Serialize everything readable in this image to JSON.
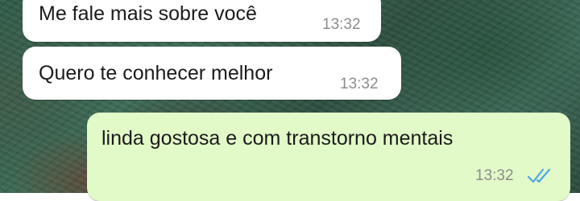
{
  "messages": [
    {
      "direction": "incoming",
      "text": "Me fale mais sobre você",
      "time": "13:32"
    },
    {
      "direction": "incoming",
      "text": "Quero te conhecer melhor",
      "time": "13:32"
    },
    {
      "direction": "outgoing",
      "text": "linda gostosa e com transtorno mentais",
      "time": "13:32",
      "status_icon": "double-check-read-icon"
    }
  ],
  "colors": {
    "incoming_bubble": "#ffffff",
    "outgoing_bubble": "#e2f9c8",
    "message_text": "#1b1b1b",
    "timestamp": "#8c8c8c",
    "read_ticks": "#4fa6e8"
  }
}
